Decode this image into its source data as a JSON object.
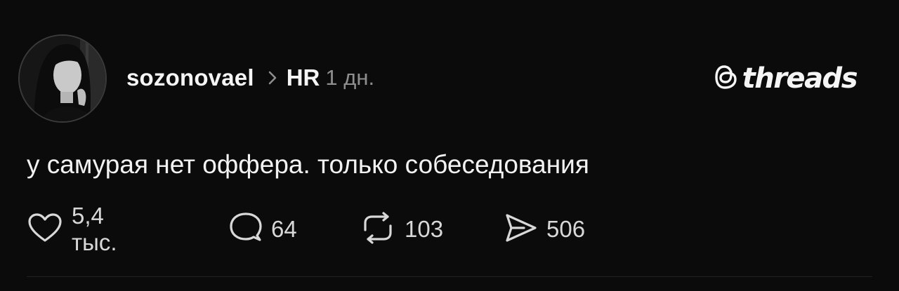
{
  "post": {
    "author": {
      "username": "sozonovael",
      "avatar_icon": "avatar-photo"
    },
    "topic": "HR",
    "separator_icon": "chevron-right-icon",
    "time_ago": "1 дн.",
    "brand": {
      "logo_icon": "threads-logo-icon",
      "text": "threads"
    },
    "text": "у самурая нет оффера. только собеседования",
    "actions": {
      "likes": {
        "icon": "heart-icon",
        "count": "5,4 тыс."
      },
      "replies": {
        "icon": "comment-icon",
        "count": "64"
      },
      "reposts": {
        "icon": "repost-icon",
        "count": "103"
      },
      "shares": {
        "icon": "send-icon",
        "count": "506"
      }
    }
  },
  "colors": {
    "background": "#0b0b0b",
    "text_primary": "#f5f5f5",
    "text_secondary": "#8e8e8e"
  }
}
